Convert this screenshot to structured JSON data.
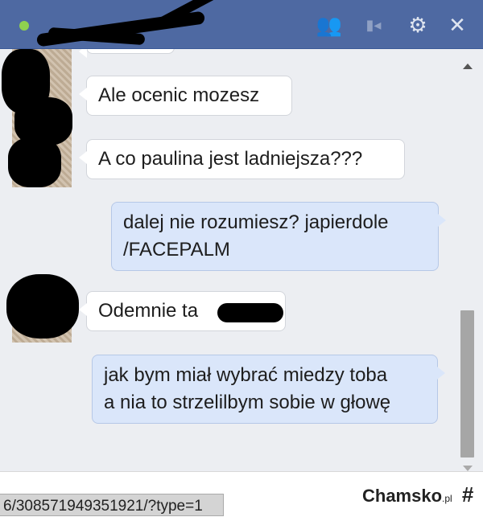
{
  "header": {
    "icons": [
      "add-friends-icon",
      "video-call-icon",
      "settings-gear-icon",
      "close-icon"
    ],
    "add_friends_glyph": "👥",
    "video_glyph": "▮◂",
    "gear_glyph": "⚙",
    "close_glyph": "✕"
  },
  "messages": [
    {
      "direction": "in",
      "text": "Ale ocenic mozesz"
    },
    {
      "direction": "in",
      "text": "A co paulina jest ladniejsza???"
    },
    {
      "direction": "out",
      "line1": "dalej nie rozumiesz? japierdole",
      "line2": "/FACEPALM"
    },
    {
      "direction": "in",
      "text": "Odemnie ta"
    },
    {
      "direction": "out",
      "line1": "jak bym miał wybrać miedzy toba",
      "line2": "a nia to strzelilbym sobie w głowę"
    }
  ],
  "status_url": "6/308571949351921/?type=1",
  "watermark": {
    "brand": "Chamsko",
    "suffix": ".pl"
  },
  "colors": {
    "header": "#4e69a2",
    "chat_bg": "#eceef2",
    "outgoing": "#dae6fa",
    "incoming": "#ffffff",
    "online": "#8fd14f"
  }
}
